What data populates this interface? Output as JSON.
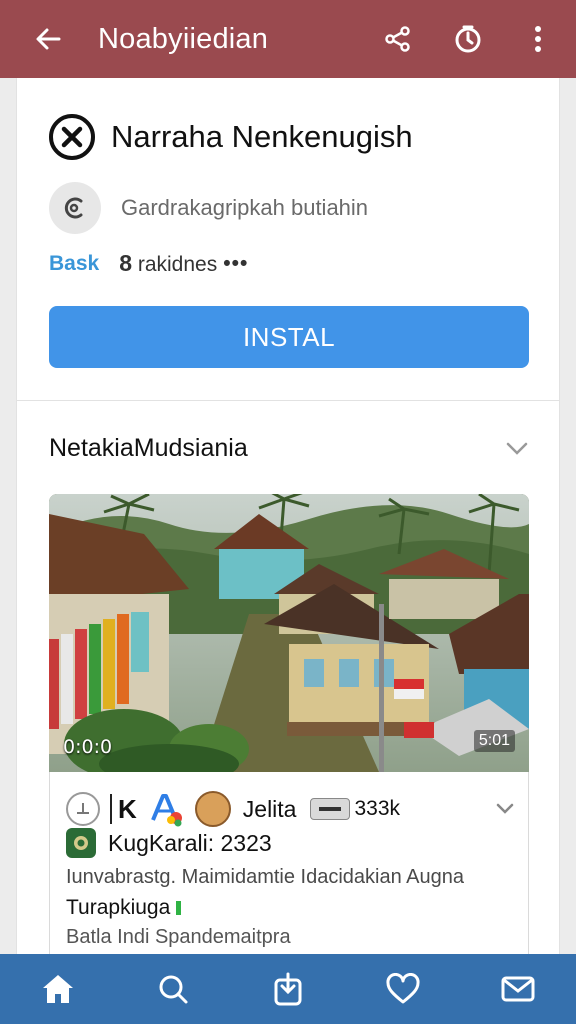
{
  "appbar": {
    "title": "Noabyiiedian",
    "icons": [
      "back-arrow-icon",
      "share-icon",
      "history-icon",
      "more-vert-icon"
    ]
  },
  "app": {
    "name": "Narraha Nenkenugish",
    "developer": "Gardrakagripkah butiahin",
    "badge": "Bask",
    "count": "8",
    "count_label": "rakidnes",
    "more": "•••",
    "install_label": "INSTAL"
  },
  "section": {
    "title": "NetakiaMudsiania"
  },
  "media": {
    "duration_left": "0:0:0",
    "duration_right": "5:01"
  },
  "post": {
    "k_label": "K",
    "user": "Jelita",
    "views": "333k",
    "title": "KugKarali: 2323",
    "description": "Iunvabrastg. Maimidamtie Idacidakian Augna",
    "subtitle": "Turapkiuga",
    "footer": "Batla Indi Spandemaitpra"
  },
  "bottomnav": {
    "items": [
      "home-icon",
      "search-icon",
      "upload-icon",
      "heart-icon",
      "mail-icon"
    ]
  },
  "colors": {
    "appbar": "#9a4a4f",
    "install": "#4194e8",
    "bottomnav": "#3570ad",
    "badge": "#3a96d8"
  }
}
